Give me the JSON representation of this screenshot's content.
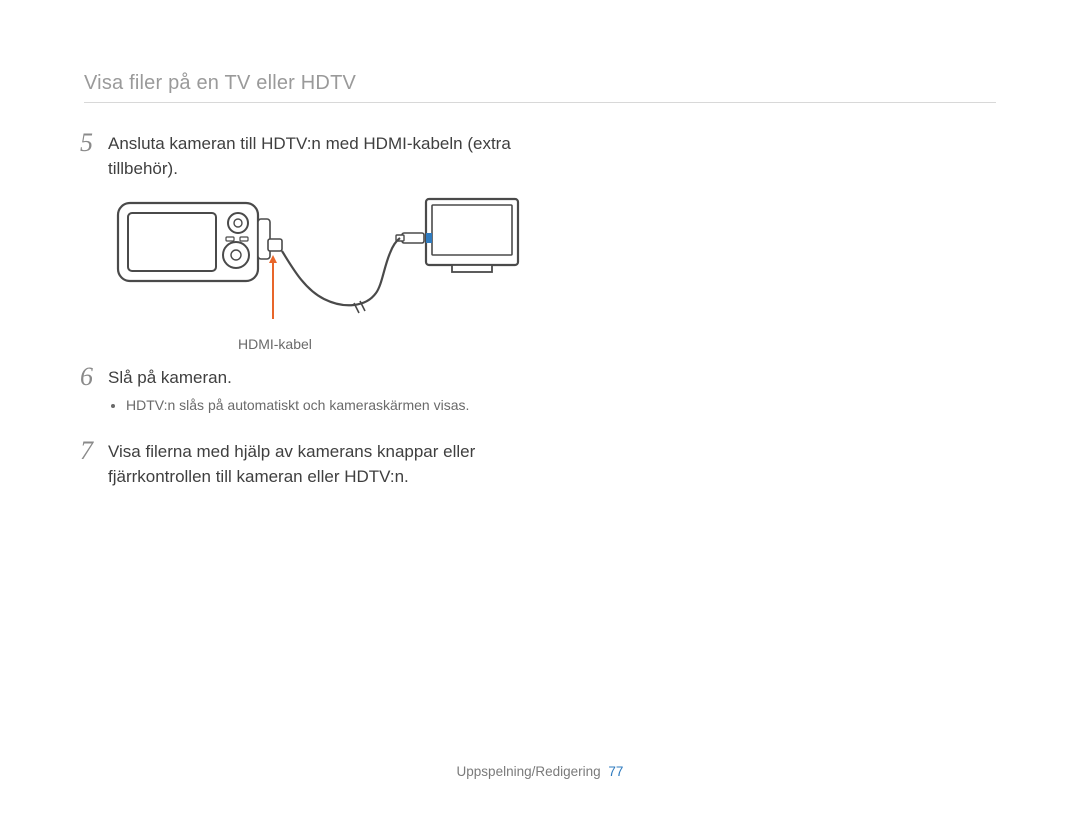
{
  "header": {
    "title": "Visa filer på en TV eller HDTV"
  },
  "steps": [
    {
      "num": "5",
      "text": "Ansluta kameran till HDTV:n med HDMI-kabeln (extra tillbehör).",
      "diagram_label": "HDMI-kabel"
    },
    {
      "num": "6",
      "text": "Slå på kameran.",
      "bullets": [
        "HDTV:n slås på automatiskt och kameraskärmen visas."
      ]
    },
    {
      "num": "7",
      "text": "Visa filerna med hjälp av kamerans knappar eller fjärrkontrollen till kameran eller HDTV:n."
    }
  ],
  "footer": {
    "section": "Uppspelning/Redigering",
    "page": "77"
  },
  "colors": {
    "accent_orange": "#e8662a",
    "accent_blue": "#2f7bbf"
  }
}
